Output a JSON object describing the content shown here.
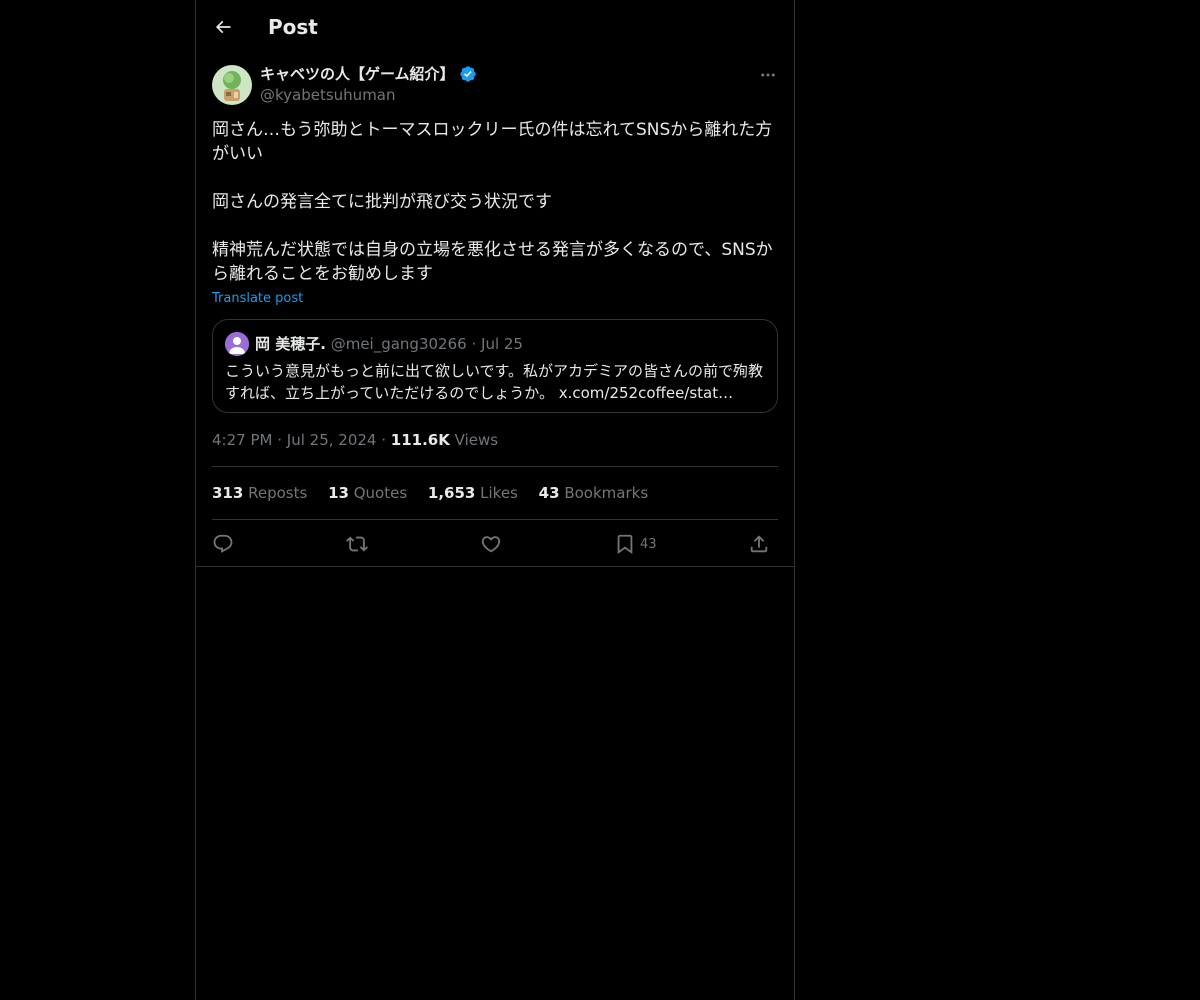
{
  "header": {
    "title": "Post",
    "back_icon": "arrow-left-icon"
  },
  "post": {
    "author_name": "キャベツの人【ゲーム紹介】",
    "author_handle": "@kyabetsuhuman",
    "verified": true,
    "verified_color": "#1d9bf0",
    "paragraphs": [
      "岡さん…もう弥助とトーマスロックリー氏の件は忘れてSNSから離れた方がいい",
      "岡さんの発言全てに批判が飛び交う状況です",
      "精神荒んだ状態では自身の立場を悪化させる発言が多くなるので、SNSから離れることをお勧めします"
    ],
    "translate_label": "Translate post",
    "time": "4:27 PM",
    "date": "Jul 25, 2024",
    "views_count": "111.6K",
    "views_label": "Views"
  },
  "quote": {
    "name": "岡 美穂子.",
    "handle": "@mei_gang30266",
    "separator": "·",
    "date": "Jul 25",
    "text": "こういう意見がもっと前に出て欲しいです。私がアカデミアの皆さんの前で殉教すれば、立ち上がっていただけるのでしょうか。 x.com/252coffee/stat…"
  },
  "stats": {
    "reposts": {
      "count": "313",
      "label": "Reposts"
    },
    "quotes": {
      "count": "13",
      "label": "Quotes"
    },
    "likes": {
      "count": "1,653",
      "label": "Likes"
    },
    "bookmarks": {
      "count": "43",
      "label": "Bookmarks"
    }
  },
  "actions": {
    "reply_icon": "reply-icon",
    "repost_icon": "repost-icon",
    "like_icon": "heart-icon",
    "bookmark_icon": "bookmark-icon",
    "bookmark_count": "43",
    "share_icon": "share-icon"
  },
  "colors": {
    "background": "#000000",
    "text": "#e7e9ea",
    "muted": "#71767b",
    "border": "#2f3336",
    "accent": "#1d9bf0"
  }
}
